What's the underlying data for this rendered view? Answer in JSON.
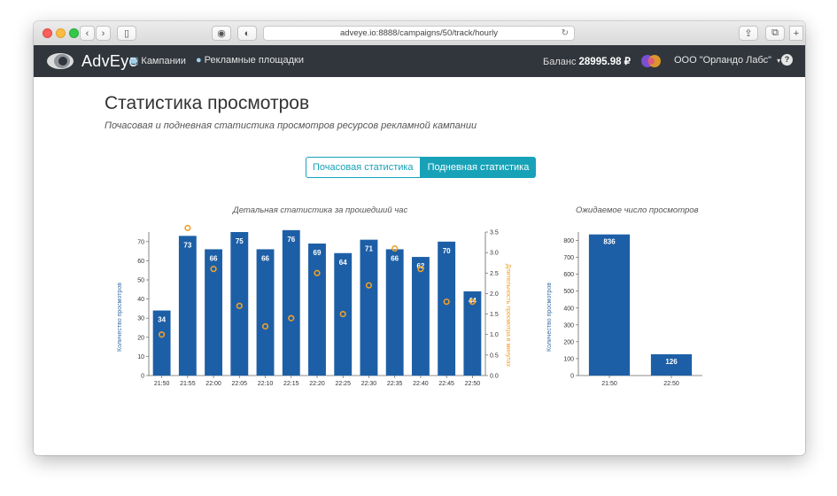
{
  "browser": {
    "url": "adveye.io:8888/campaigns/50/track/hourly"
  },
  "navbar": {
    "logo_text": "AdvEye",
    "campaigns_label": "Кампании",
    "platforms_label": "Рекламные площадки",
    "balance_label": "Баланс",
    "balance_value": "28995.98 ₽",
    "org_label": "ООО \"Орландо Лабс\"",
    "help_label": "?"
  },
  "page": {
    "title": "Статистика просмотров",
    "subtitle": "Почасовая и подневная статистика просмотров ресурсов рекламной кампании",
    "tab_hourly": "Почасовая статистика",
    "tab_daily": "Подневная статистика"
  },
  "colors": {
    "bar": "#1d5fa6",
    "dot": "#f0a028",
    "accent": "#17a2b8",
    "navbar": "#31363c"
  },
  "chart_data": [
    {
      "type": "bar",
      "title": "Детальная статистика за прошедший час",
      "categories": [
        "21:50",
        "21:55",
        "22:00",
        "22:05",
        "22:10",
        "22:15",
        "22:20",
        "22:25",
        "22:30",
        "22:35",
        "22:40",
        "22:45",
        "22:50"
      ],
      "series": [
        {
          "name": "Количество просмотров",
          "values": [
            34,
            73,
            66,
            75,
            66,
            76,
            69,
            64,
            71,
            66,
            62,
            70,
            44
          ],
          "axis": "left"
        },
        {
          "name": "Длительность просмотра в минутах",
          "values": [
            1.0,
            3.6,
            2.6,
            1.7,
            1.2,
            1.4,
            2.5,
            1.5,
            2.2,
            3.1,
            2.6,
            1.8,
            1.8
          ],
          "axis": "right",
          "type": "scatter"
        }
      ],
      "ylabel": "Количество просмотров",
      "y2label": "Длительность просмотра в минутах",
      "ylim": [
        0,
        75
      ],
      "y2lim": [
        0,
        3.5
      ],
      "yticks": [
        0,
        10,
        20,
        30,
        40,
        50,
        60,
        70
      ],
      "y2ticks": [
        "0.0",
        "0.5",
        "1.0",
        "1.5",
        "2.0",
        "2.5",
        "3.0",
        "3.5"
      ]
    },
    {
      "type": "bar",
      "title": "Ожидаемое число просмотров",
      "categories": [
        "21:50",
        "22:50"
      ],
      "values": [
        836,
        126
      ],
      "ylabel": "Количество просмотров",
      "ylim": [
        0,
        850
      ],
      "yticks": [
        0,
        100,
        200,
        300,
        400,
        500,
        600,
        700,
        800
      ]
    }
  ]
}
